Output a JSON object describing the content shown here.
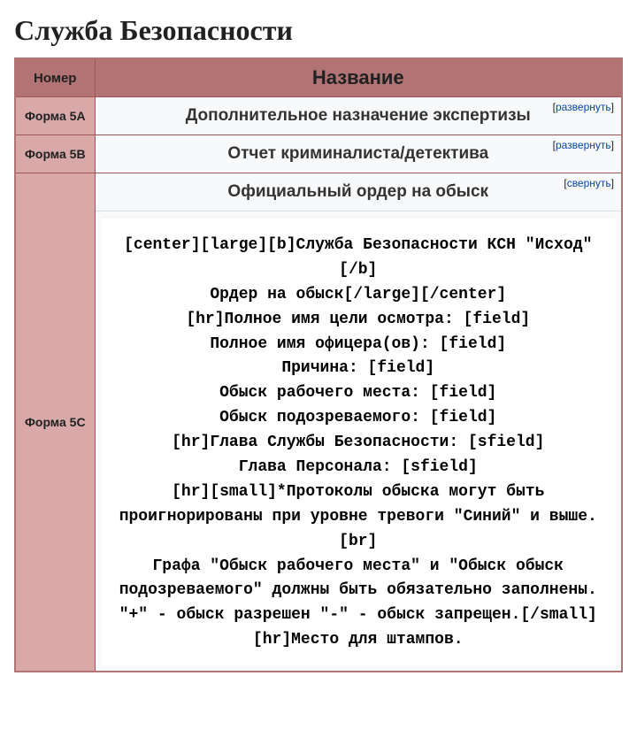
{
  "heading": "Служба Безопасности",
  "columns": {
    "num": "Номер",
    "name": "Название"
  },
  "toggle": {
    "expand": "развернуть",
    "collapse": "свернуть"
  },
  "rows": [
    {
      "num": "Форма 5A",
      "title": "Дополнительное назначение экспертизы",
      "expanded": false
    },
    {
      "num": "Форма 5B",
      "title": "Отчет криминалиста/детектива",
      "expanded": false
    },
    {
      "num": "Форма 5C",
      "title": "Официальный ордер на обыск",
      "expanded": true,
      "body": "[center][large][b]Служба Безопасности КСН \"Исход\"[/b]\nОрдер на обыск[/large][/center]\n[hr]Полное имя цели осмотра: [field]\nПолное имя офицера(ов): [field]\nПричина: [field]\nОбыск рабочего места: [field]\nОбыск подозреваемого: [field]\n[hr]Глава Службы Безопасности: [sfield]\nГлава Персонала: [sfield]\n[hr][small]*Протоколы обыска могут быть проигнорированы при уровне тревоги \"Синий\" и выше.[br]\nГрафа \"Обыск рабочего места\" и \"Обыск обыск подозреваемого\" должны быть обязательно заполнены.\n\"+\" - обыск разрешен \"-\" - обыск запрещен.[/small]\n[hr]Место для штампов."
    }
  ]
}
